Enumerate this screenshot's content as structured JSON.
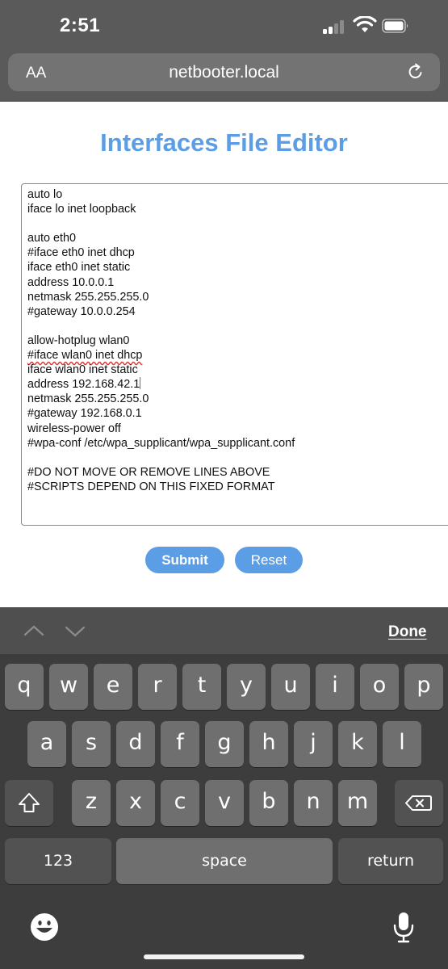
{
  "status_bar": {
    "time": "2:51"
  },
  "browser": {
    "aa_label": "AA",
    "url": "netbooter.local"
  },
  "page": {
    "title": "Interfaces File Editor",
    "file_lines": [
      "auto lo",
      "iface lo inet loopback",
      "",
      "auto eth0",
      "#iface eth0 inet dhcp",
      "iface eth0 inet static",
      "address 10.0.0.1",
      "netmask 255.255.255.0",
      "#gateway 10.0.0.254",
      "",
      "allow-hotplug wlan0",
      "#iface wlan0 inet dhcp",
      "iface wlan0 inet static",
      "address 192.168.42.1",
      "netmask 255.255.255.0",
      "#gateway 192.168.0.1",
      "wireless-power off",
      "#wpa-conf /etc/wpa_supplicant/wpa_supplicant.conf",
      "",
      "#DO NOT MOVE OR REMOVE LINES ABOVE",
      "#SCRIPTS DEPEND ON THIS FIXED FORMAT"
    ],
    "submit_label": "Submit",
    "reset_label": "Reset"
  },
  "keyboard": {
    "done_label": "Done",
    "row1": [
      "q",
      "w",
      "e",
      "r",
      "t",
      "y",
      "u",
      "i",
      "o",
      "p"
    ],
    "row2": [
      "a",
      "s",
      "d",
      "f",
      "g",
      "h",
      "j",
      "k",
      "l"
    ],
    "row3": [
      "z",
      "x",
      "c",
      "v",
      "b",
      "n",
      "m"
    ],
    "numbers_label": "123",
    "space_label": "space",
    "return_label": "return"
  },
  "colors": {
    "accent": "#5b9ee5",
    "chrome": "#5a5a5a",
    "keyboard_bg": "#3d3d3d",
    "key": "#6f6f6f"
  }
}
